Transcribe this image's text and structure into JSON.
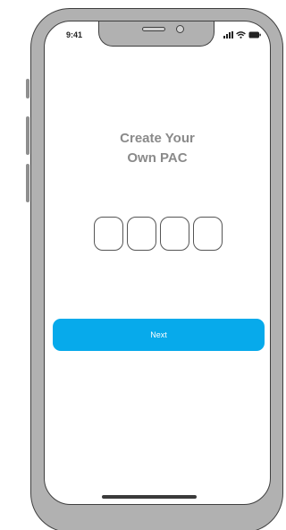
{
  "status_bar": {
    "time": "9:41",
    "icons": [
      "signal-icon",
      "wifi-icon",
      "battery-icon"
    ]
  },
  "screen": {
    "title_line1": "Create Your",
    "title_line2": "Own PAC",
    "pin_length": 4,
    "next_label": "Next"
  },
  "colors": {
    "accent": "#07aaeb",
    "title_text": "#8a8a8a",
    "device_frame": "#b1b1b1"
  }
}
